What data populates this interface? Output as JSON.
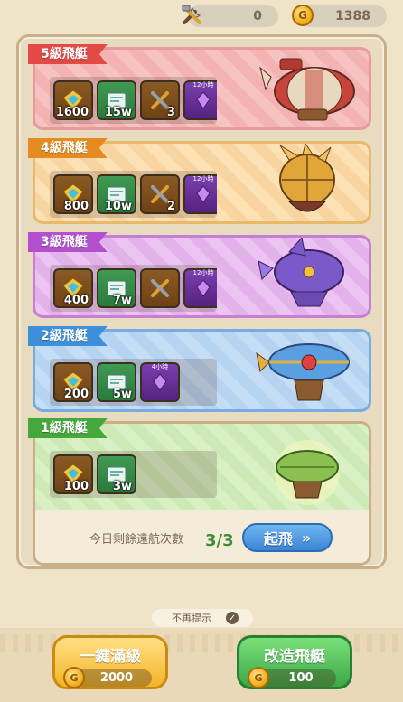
{
  "topbar": {
    "tools_value": "0",
    "coins_value": "1388"
  },
  "tiers": [
    {
      "label": "5級飛艇",
      "color": "#e24a46",
      "items": [
        {
          "icon": "gem-chest-icon",
          "count": "1600"
        },
        {
          "icon": "blueprint-icon",
          "count": "15w"
        },
        {
          "icon": "tools-icon",
          "count": "3"
        },
        {
          "icon": "crystal-icon",
          "count": "",
          "time": "12小時"
        }
      ]
    },
    {
      "label": "4級飛艇",
      "color": "#e68b1f",
      "items": [
        {
          "icon": "gem-chest-icon",
          "count": "800"
        },
        {
          "icon": "blueprint-icon",
          "count": "10w"
        },
        {
          "icon": "tools-icon",
          "count": "2"
        },
        {
          "icon": "crystal-icon",
          "count": "",
          "time": "12小時"
        }
      ]
    },
    {
      "label": "3級飛艇",
      "color": "#b44fd0",
      "items": [
        {
          "icon": "gem-chest-icon",
          "count": "400"
        },
        {
          "icon": "blueprint-icon",
          "count": "7w"
        },
        {
          "icon": "tools-icon",
          "count": ""
        },
        {
          "icon": "crystal-icon",
          "count": "",
          "time": "12小時"
        }
      ]
    },
    {
      "label": "2級飛艇",
      "color": "#3c8fd9",
      "items": [
        {
          "icon": "gem-chest-icon",
          "count": "200"
        },
        {
          "icon": "blueprint-icon",
          "count": "5w"
        },
        {
          "icon": "crystal-icon",
          "count": "",
          "time": "4小時"
        }
      ]
    },
    {
      "label": "1級飛艇",
      "color": "#44a83b",
      "items": [
        {
          "icon": "gem-chest-icon",
          "count": "100"
        },
        {
          "icon": "blueprint-icon",
          "count": "3w"
        }
      ]
    }
  ],
  "voyage": {
    "label": "今日剩餘遠航次數",
    "count": "3/3",
    "launch_label": "起飛",
    "launch_arrows": "»"
  },
  "hint": {
    "label": "不再提示",
    "check": "✓"
  },
  "buttons": {
    "max_level": {
      "label": "一鍵滿級",
      "price": "2000"
    },
    "modify": {
      "label": "改造飛艇",
      "price": "100"
    }
  }
}
